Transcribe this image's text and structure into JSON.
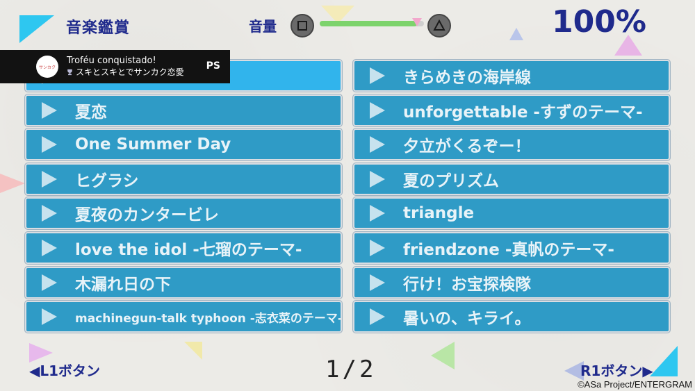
{
  "header": {
    "title": "音楽鑑賞",
    "volume_label": "音量",
    "volume_level": 0.93,
    "volume_down_button": "square-button",
    "volume_up_button": "triangle-button",
    "percent": "100%"
  },
  "notification": {
    "title": "Troféu conquistado!",
    "trophy_name": "スキとスキとでサンカク恋愛",
    "icon": "playstation-icon"
  },
  "tracks_left": [
    {
      "name": ""
    },
    {
      "name": "夏恋"
    },
    {
      "name": "One Summer Day"
    },
    {
      "name": "ヒグラシ"
    },
    {
      "name": "夏夜のカンタービレ"
    },
    {
      "name": "love the idol -七瑠のテーマ-"
    },
    {
      "name": "木漏れ日の下"
    },
    {
      "name": "machinegun-talk typhoon -志衣菜のテーマ-"
    }
  ],
  "tracks_right": [
    {
      "name": "きらめきの海岸線"
    },
    {
      "name": "unforgettable -すずのテーマ-"
    },
    {
      "name": "夕立がくるぞー！"
    },
    {
      "name": "夏のプリズム"
    },
    {
      "name": "triangle"
    },
    {
      "name": "friendzone -真帆のテーマ-"
    },
    {
      "name": "行け！お宝探検隊"
    },
    {
      "name": "暑いの、キライ。"
    }
  ],
  "footer": {
    "prev_label": "◀L1ボタン",
    "next_label": "R1ボタン▶",
    "page": "1/2",
    "copyright": "©ASa Project/ENTERGRAM"
  },
  "colors": {
    "title": "#1f2a8c",
    "track_bg": "#2f9bc6",
    "track_selected": "#31b4ec",
    "volume_fill": "#7dd36c"
  }
}
